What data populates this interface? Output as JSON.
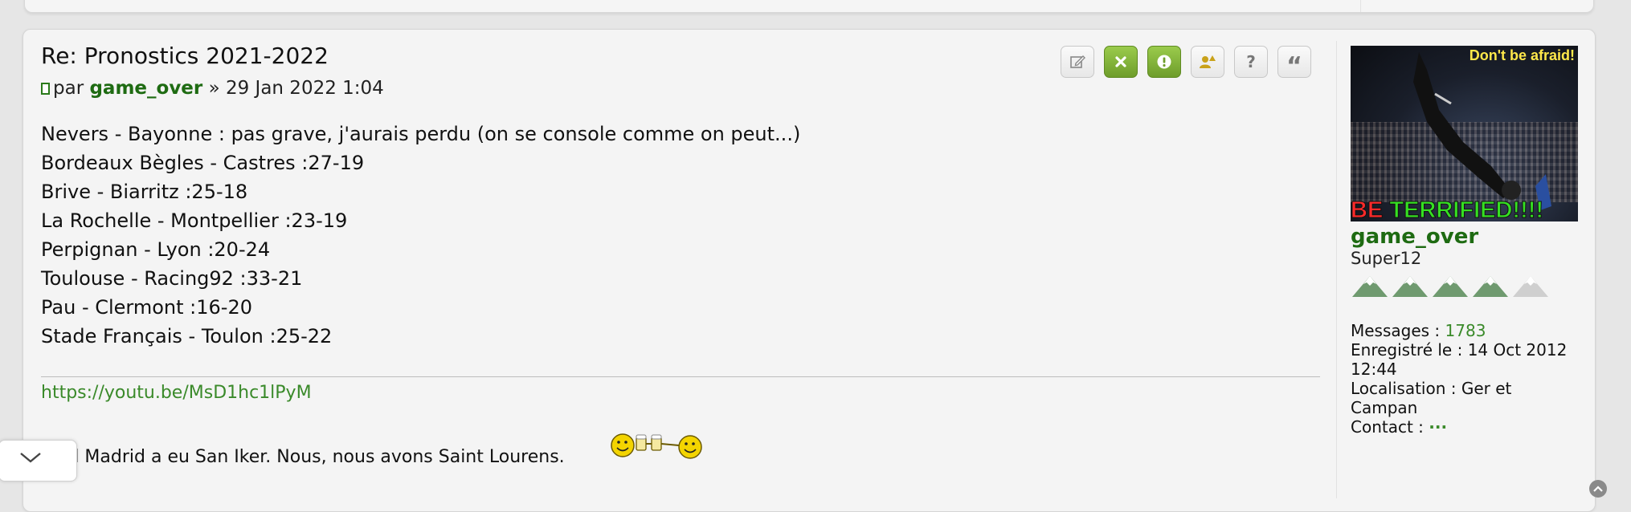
{
  "post": {
    "title": "Re: Pronostics 2021-2022",
    "byline": {
      "by_word": "par",
      "author": "game_over",
      "separator": "»",
      "datetime": "29 Jan 2022 1:04"
    },
    "actions": [
      {
        "name": "edit-post-button",
        "icon": "pencil-icon"
      },
      {
        "name": "delete-post-button",
        "icon": "x-icon"
      },
      {
        "name": "report-post-button",
        "icon": "exclamation-icon"
      },
      {
        "name": "warn-user-button",
        "icon": "user-warning-icon"
      },
      {
        "name": "information-button",
        "icon": "question-icon"
      },
      {
        "name": "quote-button",
        "icon": "quote-icon"
      }
    ],
    "content_lines": [
      "Nevers - Bayonne : pas grave, j'aurais perdu (on se console comme on peut...)",
      "Bordeaux Bègles - Castres :27-19",
      "Brive - Biarritz :25-18",
      "La Rochelle - Montpellier :23-19",
      "Perpignan - Lyon :20-24",
      "Toulouse - Racing92 :33-21",
      "Pau - Clermont :16-20",
      "Stade Français - Toulon :25-22"
    ],
    "signature": {
      "link": "https://youtu.be/MsD1hc1lPyM",
      "quote": "Real Madrid a eu San Iker. Nous, nous avons Saint Lourens."
    }
  },
  "profile": {
    "avatar_caption": "Don't be afraid!",
    "avatar_banner_red": "BE",
    "avatar_banner_green": " TERRIFIED!!!!",
    "username": "game_over",
    "rank": "Super12",
    "messages_label": "Messages :",
    "messages_value": "1783",
    "registered_label": "Enregistré le :",
    "registered_value": "14 Oct 2012 12:44",
    "location_label": "Localisation :",
    "location_value": "Ger et Campan",
    "contact_label": "Contact :",
    "contact_value": "···"
  },
  "colors": {
    "accent_green": "#1e6b12",
    "link_green": "#3a8a2a",
    "button_green": "#7fb23a"
  }
}
